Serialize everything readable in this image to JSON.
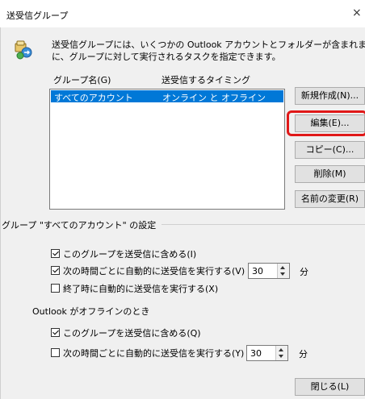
{
  "window": {
    "title": "送受信グループ",
    "close_glyph": "×"
  },
  "description": {
    "line1": "送受信グループには、いくつかの Outlook アカウントとフォルダーが含まれます。送受信中",
    "line2": "に、グループに対して実行されるタスクを指定できます。"
  },
  "list": {
    "col_name": "グループ名(G)",
    "col_timing": "送受信するタイミング",
    "rows": [
      {
        "name": "すべてのアカウント",
        "timing": "オンライン と オフライン"
      }
    ]
  },
  "buttons": {
    "new": "新規作成(N)...",
    "edit": "編集(E)...",
    "copy": "コピー(C)...",
    "delete": "削除(M)",
    "rename": "名前の変更(R)",
    "close": "閉じる(L)"
  },
  "group_settings": {
    "heading": "グループ \"すべてのアカウント\" の設定",
    "online": {
      "include_label": "このグループを送受信に含める(I)",
      "include_checked": true,
      "auto_label": "次の時間ごとに自動的に送受信を実行する(V)",
      "auto_checked": true,
      "auto_minutes": "30",
      "unit": "分",
      "on_exit_label": "終了時に自動的に送受信を実行する(X)",
      "on_exit_checked": false
    },
    "offline_heading": "Outlook がオフラインのとき",
    "offline": {
      "include_label": "このグループを送受信に含める(Q)",
      "include_checked": true,
      "auto_label": "次の時間ごとに自動的に送受信を実行する(Y)",
      "auto_checked": false,
      "auto_minutes": "30",
      "unit": "分"
    }
  },
  "colors": {
    "selection": "#0078d7",
    "highlight": "#e01818",
    "dialog_bg": "#f0f0f0"
  }
}
